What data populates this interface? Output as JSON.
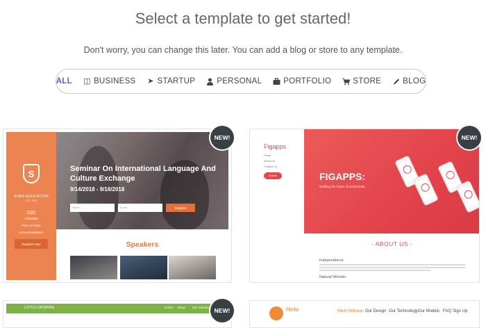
{
  "heading": "Select a template to get started!",
  "subheading": "Don't worry, you can change this later. You can add a blog or store to any template.",
  "filters": [
    {
      "label": "ALL",
      "icon": "none",
      "active": true
    },
    {
      "label": "BUSINESS",
      "icon": "document-icon",
      "active": false
    },
    {
      "label": "STARTUP",
      "icon": "rocket-icon",
      "active": false
    },
    {
      "label": "PERSONAL",
      "icon": "person-icon",
      "active": false
    },
    {
      "label": "PORTFOLIO",
      "icon": "briefcase-icon",
      "active": false
    },
    {
      "label": "STORE",
      "icon": "cart-icon",
      "active": false
    },
    {
      "label": "BLOG",
      "icon": "pen-icon",
      "active": false
    }
  ],
  "colors": {
    "accent": "#6a5bc4",
    "badge": "#3a3f45",
    "education_orange": "#ec8452",
    "figapps_red": "#e4484e",
    "lotus_green": "#7fb049"
  },
  "new_badge": "NEW!",
  "templates": {
    "education": {
      "brand": "SORA EDUCATION",
      "established": "EST. 1920",
      "nav": [
        "Home",
        "Schedule",
        "Price & Place",
        "Accommodations"
      ],
      "nav_button": "Register Now",
      "title": "Seminar On International Language And Culture Exchange",
      "dates": "9/14/2018 - 9/16/2018",
      "input_name": "Name",
      "input_email": "Email",
      "register": "Register",
      "speakers": "Speakers"
    },
    "figapps": {
      "logo": "Figapps",
      "links": [
        "Home",
        "About Us",
        "Contact Us"
      ],
      "submit": "Submit",
      "title": "FIGAPPS:",
      "tagline": "Building the future of productivity.",
      "about": "- ABOUT US -",
      "independence": "Independence",
      "wonder": "Natural Wonder"
    },
    "catering": {
      "brand": "LOTUS CATERING",
      "nav": [
        "Home",
        "About",
        "Our Selection"
      ]
    },
    "hello": {
      "brand": "Hello",
      "nav": [
        "Meet Helloear",
        "Our Design",
        "Our Technology",
        "Our Models",
        "FAQ",
        "Sign Up"
      ]
    }
  }
}
